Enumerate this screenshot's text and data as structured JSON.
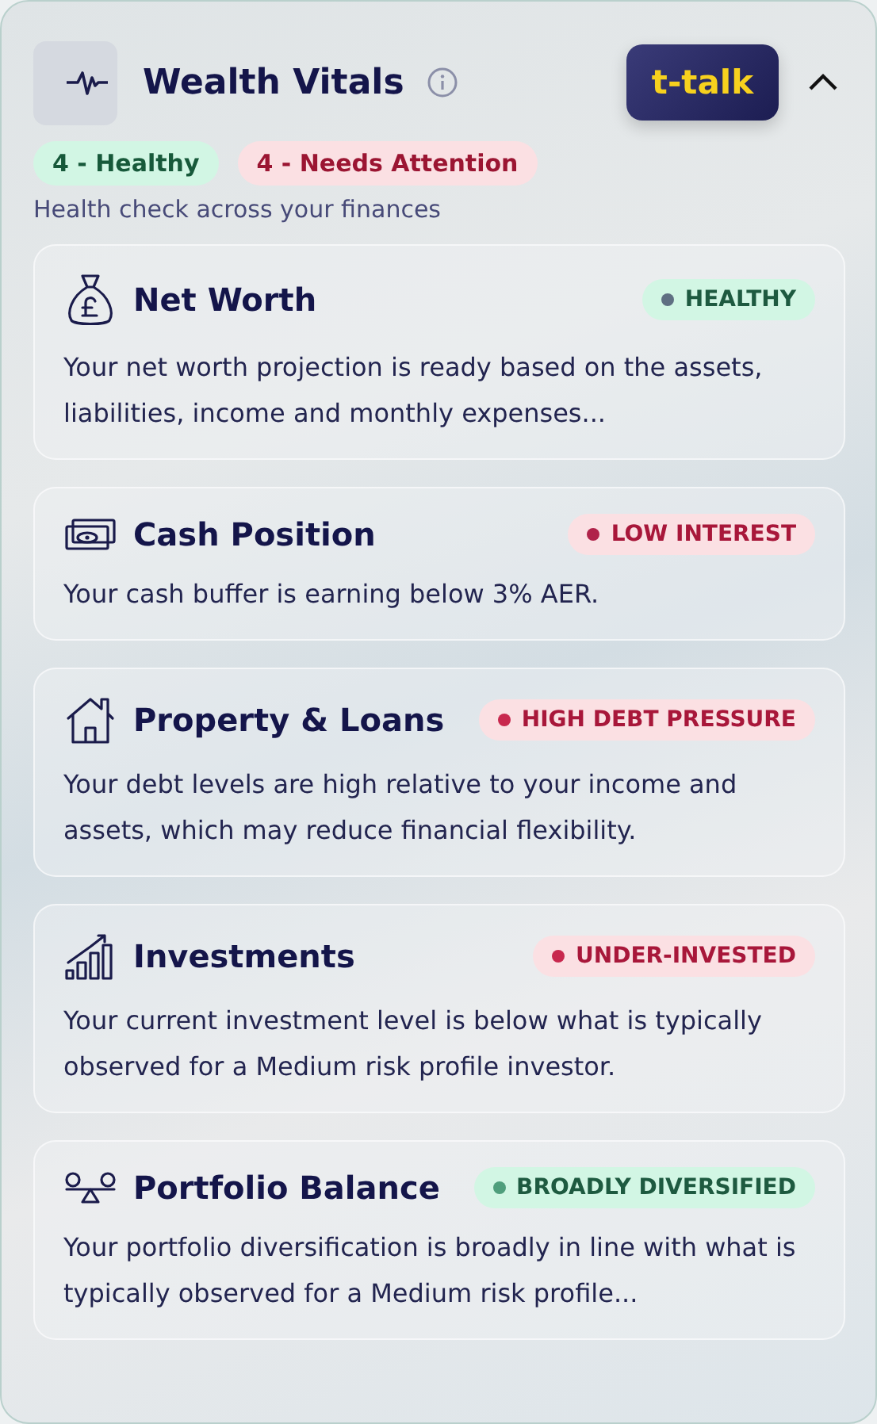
{
  "header": {
    "title": "Wealth Vitals",
    "talk_button": "t-talk",
    "expanded": true
  },
  "summary_chips": [
    {
      "label": "4 - Healthy",
      "kind": "healthy"
    },
    {
      "label": "4 - Needs Attention",
      "kind": "attention"
    }
  ],
  "subtitle": "Health check across your finances",
  "cards": [
    {
      "title": "Net Worth",
      "status": {
        "label": "HEALTHY",
        "kind": "healthy",
        "color": "#5f6f82"
      },
      "text": "Your net worth projection is ready based on the assets, liabilities, income and monthly expenses..."
    },
    {
      "title": "Cash Position",
      "status": {
        "label": "LOW INTEREST",
        "kind": "attention",
        "color": "#b0234a"
      },
      "text": "Your cash buffer is earning below 3% AER."
    },
    {
      "title": "Property & Loans",
      "status": {
        "label": "HIGH DEBT PRESSURE",
        "kind": "attention",
        "color": "#c8284e"
      },
      "text": "Your debt levels are high relative to your income and assets, which may reduce financial flexibility."
    },
    {
      "title": "Investments",
      "status": {
        "label": "UNDER-INVESTED",
        "kind": "attention",
        "color": "#c8284e"
      },
      "text": "Your current investment level is below what is typically observed for a Medium risk profile investor."
    },
    {
      "title": "Portfolio Balance",
      "status": {
        "label": "BROADLY DIVERSIFIED",
        "kind": "healthy",
        "color": "#4f9e7c"
      },
      "text": "Your portfolio diversification is broadly in line with what is typically observed for a Medium risk profile..."
    }
  ]
}
